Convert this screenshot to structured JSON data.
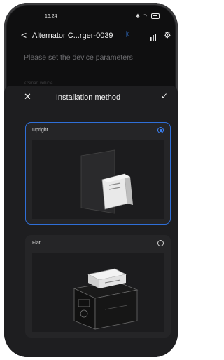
{
  "status_bar": {
    "time": "16:24"
  },
  "header": {
    "back_label": "<",
    "title": "Alternator C...rger-0039"
  },
  "page": {
    "subtitle": "Please set the device parameters",
    "faded_row": "< Smart vehicle"
  },
  "sheet": {
    "close_label": "✕",
    "title": "Installation method",
    "confirm_label": "✓",
    "options": [
      {
        "label": "Upright",
        "selected": true
      },
      {
        "label": "Flat",
        "selected": false
      }
    ]
  },
  "colors": {
    "accent": "#3b82f6",
    "background": "#0f0f10",
    "sheet": "#1e1e20"
  }
}
